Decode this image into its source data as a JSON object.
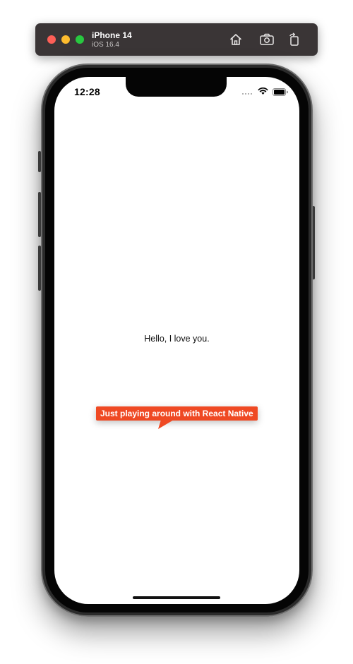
{
  "simulator": {
    "device_name": "iPhone 14",
    "os_version": "iOS 16.4",
    "buttons": {
      "home": "home-icon",
      "screenshot": "screenshot-icon",
      "rotate": "rotate-icon"
    }
  },
  "status_bar": {
    "time": "12:28"
  },
  "app": {
    "greeting": "Hello, I love you.",
    "tooltip_text": "Just playing around with React Native"
  },
  "colors": {
    "tooltip_bg": "#ef4923",
    "sim_bar_bg": "#3a3536"
  }
}
